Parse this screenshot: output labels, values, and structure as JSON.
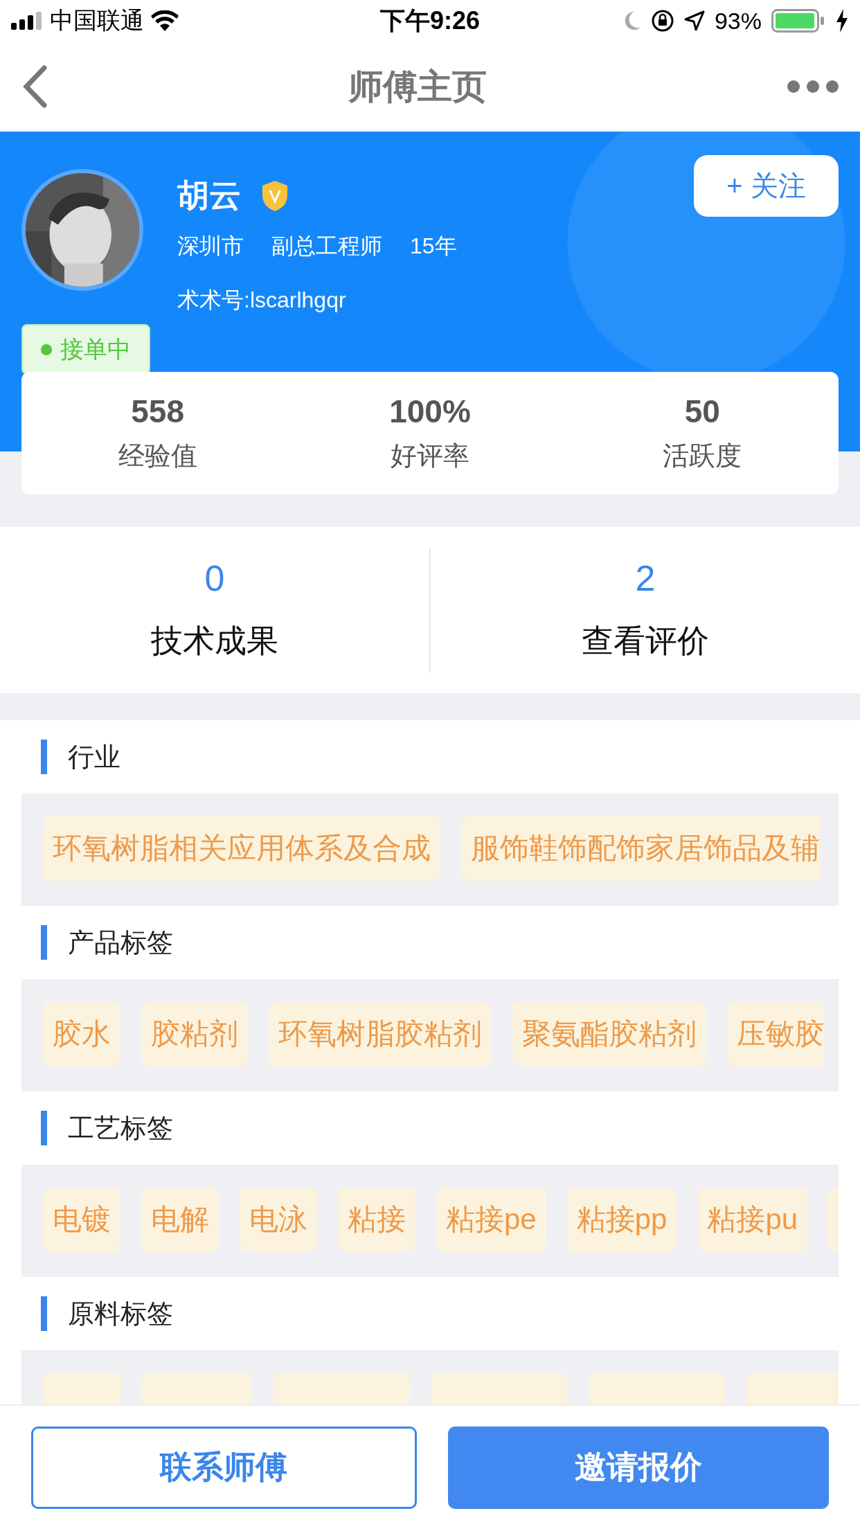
{
  "status_bar": {
    "carrier": "中国联通",
    "time": "下午9:26",
    "battery": "93%"
  },
  "nav": {
    "title": "师傅主页"
  },
  "profile": {
    "name": "胡云",
    "verified": true,
    "city": "深圳市",
    "position": "副总工程师",
    "years": "15年",
    "account": "术术号:lscarlhgqr",
    "follow_button": "+ 关注",
    "status": "接单中"
  },
  "stats": [
    {
      "value": "558",
      "label": "经验值"
    },
    {
      "value": "100%",
      "label": "好评率"
    },
    {
      "value": "50",
      "label": "活跃度"
    }
  ],
  "counts": [
    {
      "value": "0",
      "label": "技术成果"
    },
    {
      "value": "2",
      "label": "查看评价"
    }
  ],
  "tag_sections": [
    {
      "title": "行业",
      "tags": [
        {
          "kind": "text",
          "label": "环氧树脂相关应用体系及合成"
        },
        {
          "kind": "text",
          "label": "服饰鞋饰配饰家居饰品及辅"
        }
      ]
    },
    {
      "title": "产品标签",
      "tags": [
        {
          "kind": "text",
          "label": "胶水"
        },
        {
          "kind": "text",
          "label": "胶粘剂"
        },
        {
          "kind": "text",
          "label": "环氧树脂胶粘剂"
        },
        {
          "kind": "text",
          "label": "聚氨酯胶粘剂"
        },
        {
          "kind": "text",
          "label": "压敏胶"
        }
      ]
    },
    {
      "title": "工艺标签",
      "tags": [
        {
          "kind": "text",
          "label": "电镀"
        },
        {
          "kind": "text",
          "label": "电解"
        },
        {
          "kind": "text",
          "label": "电泳"
        },
        {
          "kind": "text",
          "label": "粘接"
        },
        {
          "kind": "text",
          "label": "粘接pe"
        },
        {
          "kind": "text",
          "label": "粘接pp"
        },
        {
          "kind": "text",
          "label": "粘接pu"
        },
        {
          "kind": "covered"
        }
      ]
    },
    {
      "title": "原料标签",
      "tags": [
        {
          "kind": "covered"
        },
        {
          "kind": "covered"
        },
        {
          "kind": "covered"
        },
        {
          "kind": "covered"
        },
        {
          "kind": "covered"
        },
        {
          "kind": "covered"
        }
      ]
    }
  ],
  "buttons": [
    {
      "label": "联系师傅",
      "kind": "outline"
    },
    {
      "label": "邀请报价",
      "kind": "filled"
    }
  ]
}
